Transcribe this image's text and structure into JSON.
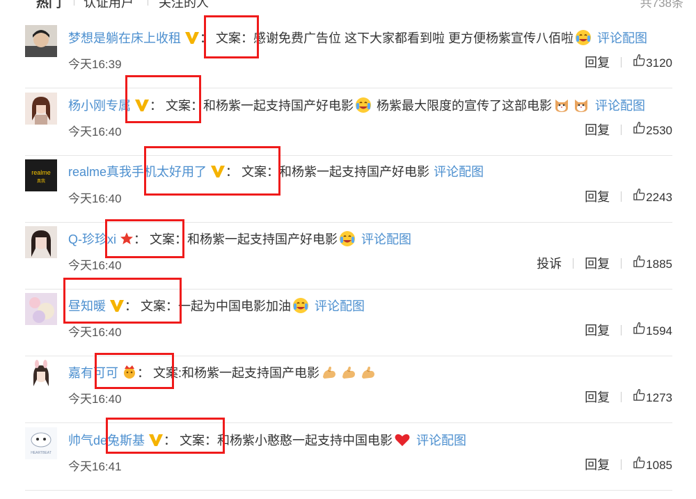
{
  "tabs": {
    "hot": "热门",
    "verified": "认证用户",
    "following": "关注的人",
    "total": "共738条"
  },
  "labels": {
    "reply": "回复",
    "report": "投诉",
    "pic": "评论配图"
  },
  "comments": [
    {
      "user": "梦想是躺在床上收租",
      "badge": "vip-v-icon",
      "colon": "：",
      "text": "文案：感谢免费广告位 这下大家都看到啦 更方便杨紫宣传八佰啦",
      "emojis": [
        "cry-laugh-emoji"
      ],
      "pic": true,
      "time": "今天16:39",
      "likes": "3120"
    },
    {
      "user": "杨小刚专属",
      "badge": "vip-v-icon",
      "colon": "：",
      "text": "文案：和杨紫一起支持国产好电影",
      "text2": "杨紫最大限度的宣传了这部电影",
      "emojis": [
        "cry-laugh-emoji"
      ],
      "emojis2": [
        "cat-emoji",
        "cat-emoji"
      ],
      "pic": true,
      "time": "今天16:40",
      "likes": "2530"
    },
    {
      "user": "realme真我手机太好用了",
      "badge": "vip-v-icon",
      "colon": "：",
      "text": "文案：和杨紫一起支持国产好电影",
      "emojis": [],
      "pic": true,
      "time": "今天16:40",
      "likes": "2243"
    },
    {
      "user": "Q-珍珍xi",
      "badge": "star-badge-icon",
      "colon": "：",
      "text": "文案：和杨紫一起支持国产好电影",
      "emojis": [
        "cry-laugh-emoji"
      ],
      "pic": true,
      "time": "今天16:40",
      "likes": "1885",
      "report": true
    },
    {
      "user": "昼知暖",
      "badge": "vip-v-icon",
      "colon": "：",
      "text": "文案：一起为中国电影加油",
      "emojis": [
        "cry-laugh-emoji"
      ],
      "pic": true,
      "time": "今天16:40",
      "likes": "1594"
    },
    {
      "user": "嘉有可可",
      "badge": "crown-badge-icon",
      "colon": "：",
      "text": "文案:和杨紫一起支持国产电影",
      "emojis": [
        "muscle-emoji",
        "muscle-emoji",
        "muscle-emoji"
      ],
      "pic": false,
      "time": "今天16:40",
      "likes": "1273"
    },
    {
      "user": "帅气de兔斯基",
      "badge": "vip-v-icon",
      "colon": "：",
      "text": "文案：和杨紫小憨憨一起支持中国电影",
      "emojis": [
        "heart-emoji"
      ],
      "pic": true,
      "time": "今天16:41",
      "likes": "1085"
    }
  ],
  "colors": {
    "link": "#4c8fcf",
    "highlight": "#ef1b1b",
    "vip": "#f5b300"
  }
}
